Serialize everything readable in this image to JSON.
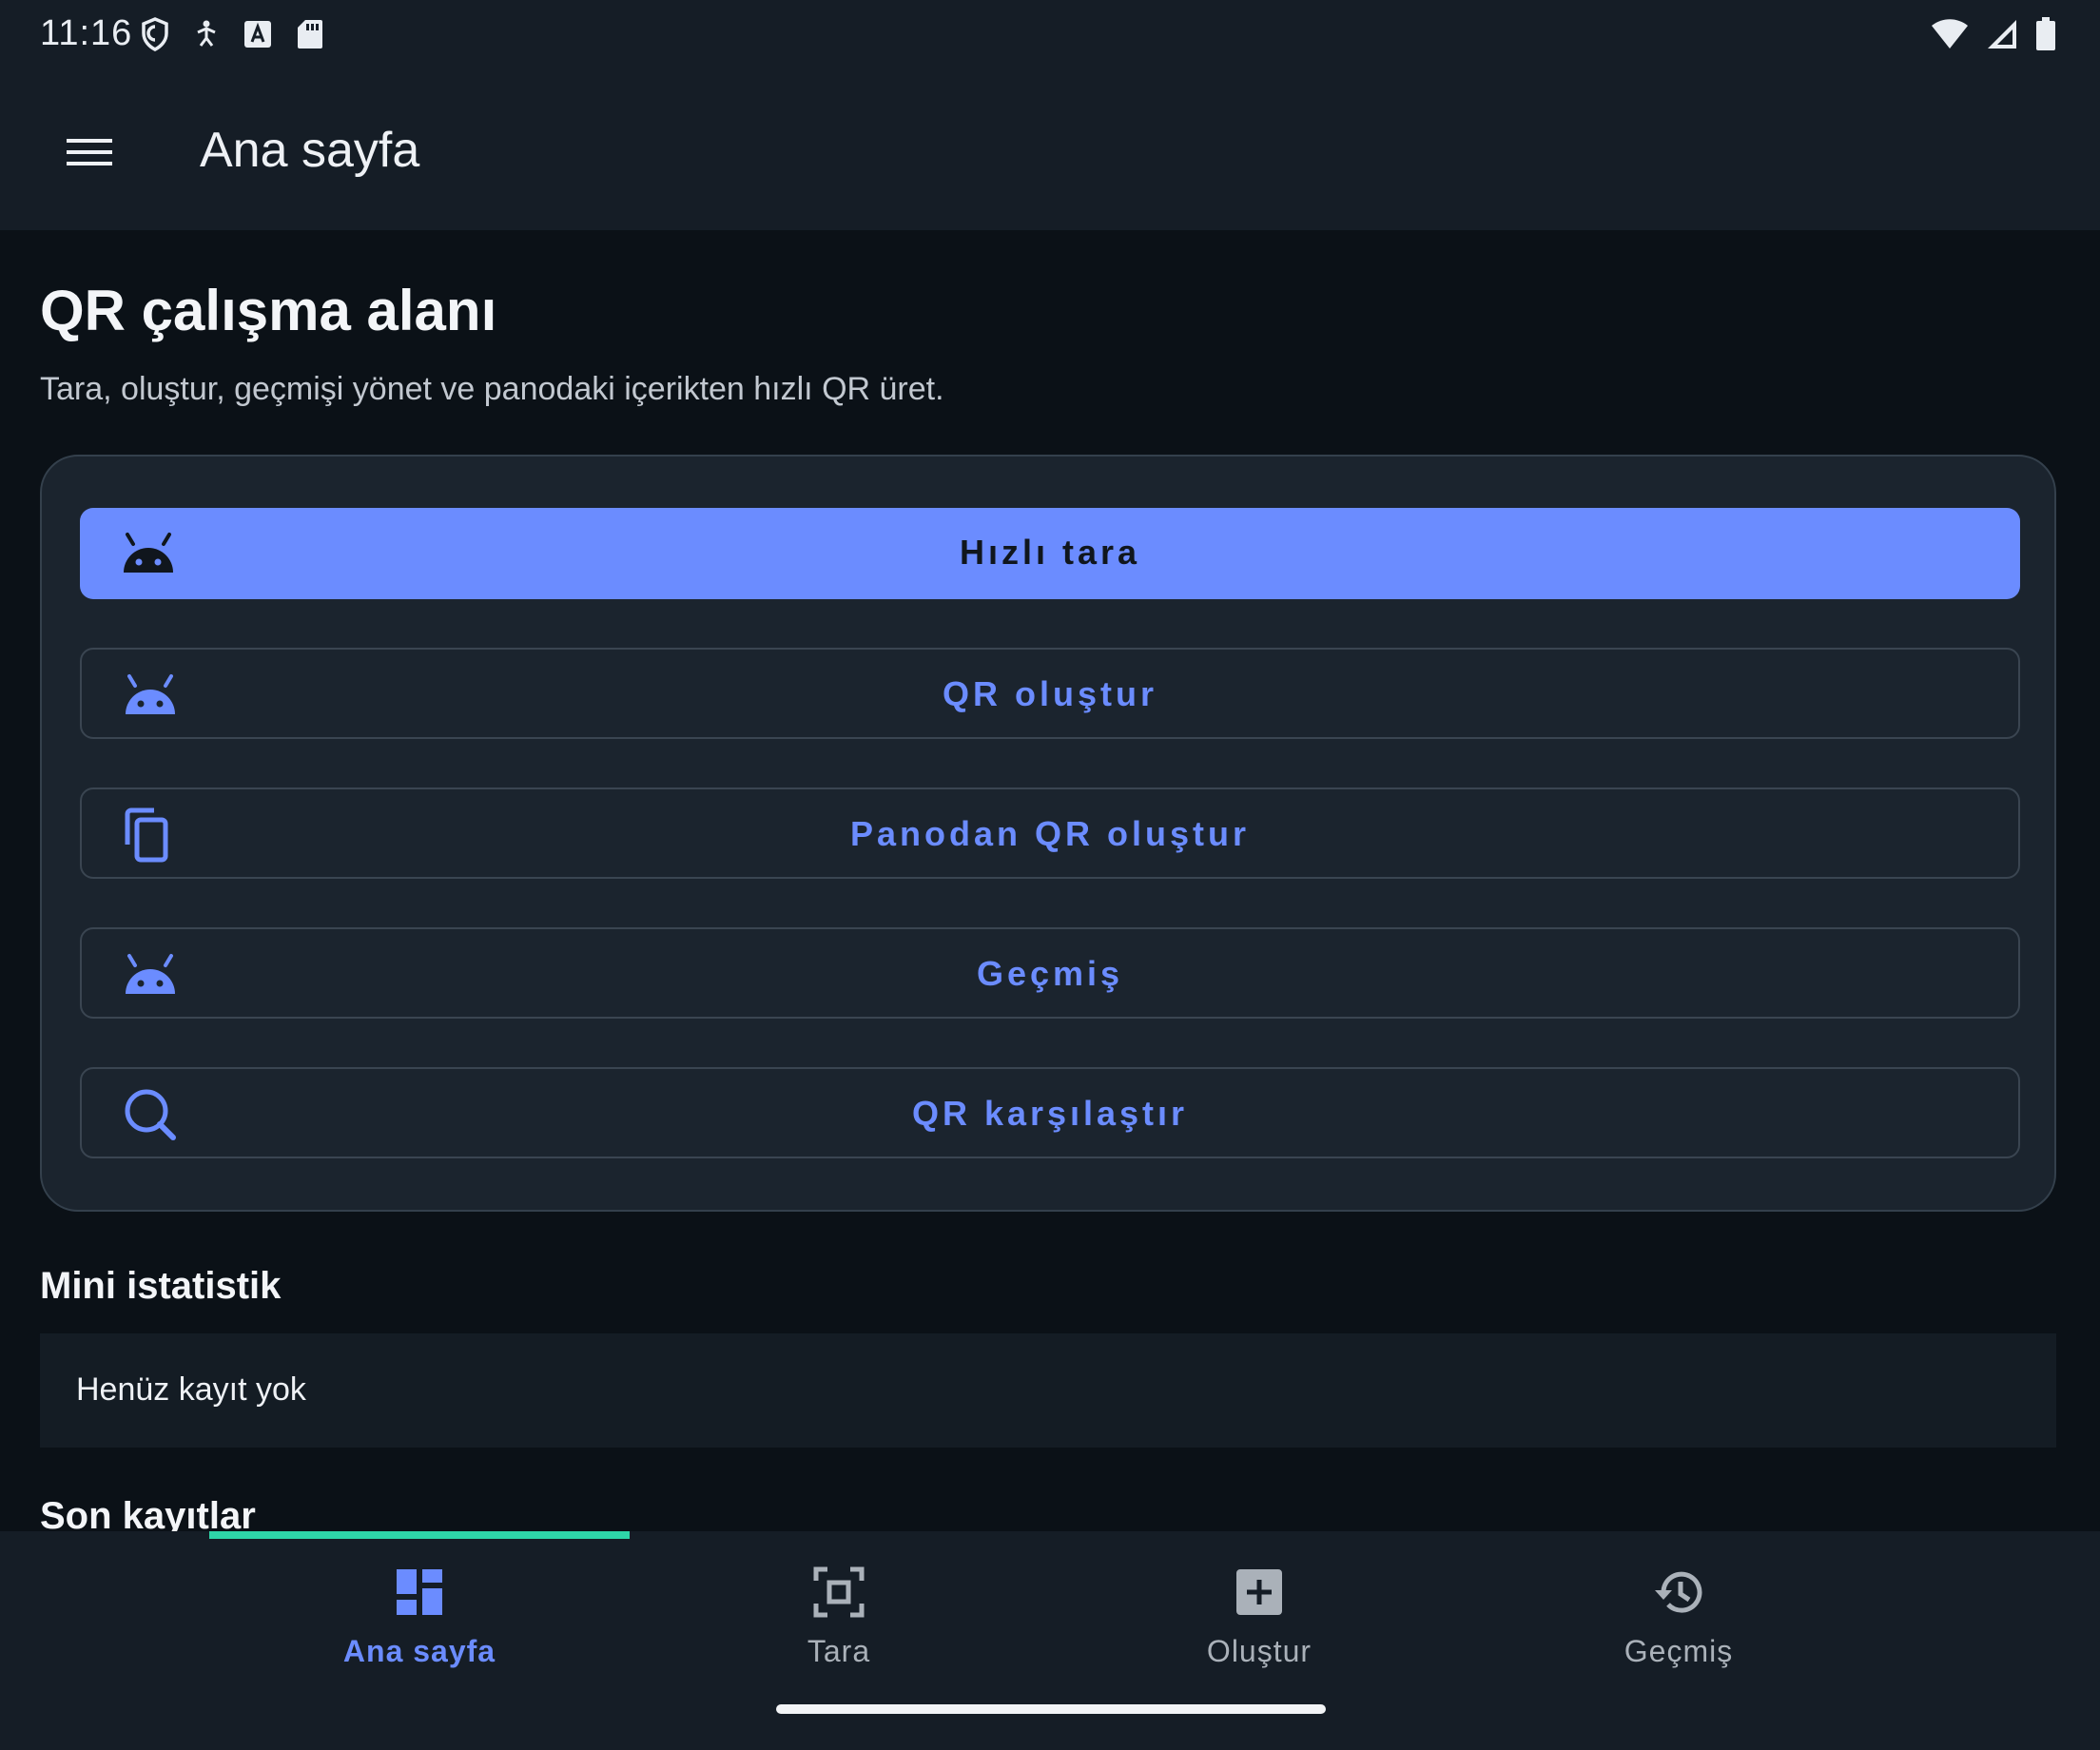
{
  "status_bar": {
    "time": "11:16",
    "left_icons": [
      "shield-icon",
      "accessibility-icon",
      "keyboard-a-icon",
      "sd-card-icon"
    ],
    "right_icons": [
      "wifi-icon",
      "signal-icon",
      "battery-icon"
    ]
  },
  "app_bar": {
    "title": "Ana sayfa",
    "menu_icon": "hamburger-menu-icon"
  },
  "header": {
    "title": "QR çalışma alanı",
    "subtitle": "Tara, oluştur, geçmişi yönet ve panodaki içerikten hızlı QR üret."
  },
  "actions": [
    {
      "label": "Hızlı tara",
      "icon": "android-icon",
      "style": "filled"
    },
    {
      "label": "QR oluştur",
      "icon": "android-icon",
      "style": "outlined"
    },
    {
      "label": "Panodan QR oluştur",
      "icon": "copy-icon",
      "style": "outlined"
    },
    {
      "label": "Geçmiş",
      "icon": "android-icon",
      "style": "outlined"
    },
    {
      "label": "QR karşılaştır",
      "icon": "search-icon",
      "style": "outlined"
    }
  ],
  "stats": {
    "title": "Mini istatistik",
    "empty_text": "Henüz kayıt yok"
  },
  "recent": {
    "title": "Son kayıtlar"
  },
  "bottom_nav": {
    "items": [
      {
        "label": "Ana sayfa",
        "icon": "dashboard-icon",
        "active": true
      },
      {
        "label": "Tara",
        "icon": "scan-icon",
        "active": false
      },
      {
        "label": "Oluştur",
        "icon": "add-box-icon",
        "active": false
      },
      {
        "label": "Geçmiş",
        "icon": "history-icon",
        "active": false
      }
    ]
  },
  "colors": {
    "accent": "#6b8cff",
    "background": "#0b1117",
    "surface": "#1b242e",
    "bar": "#151d26",
    "nav_indicator": "#2ed5a8"
  }
}
